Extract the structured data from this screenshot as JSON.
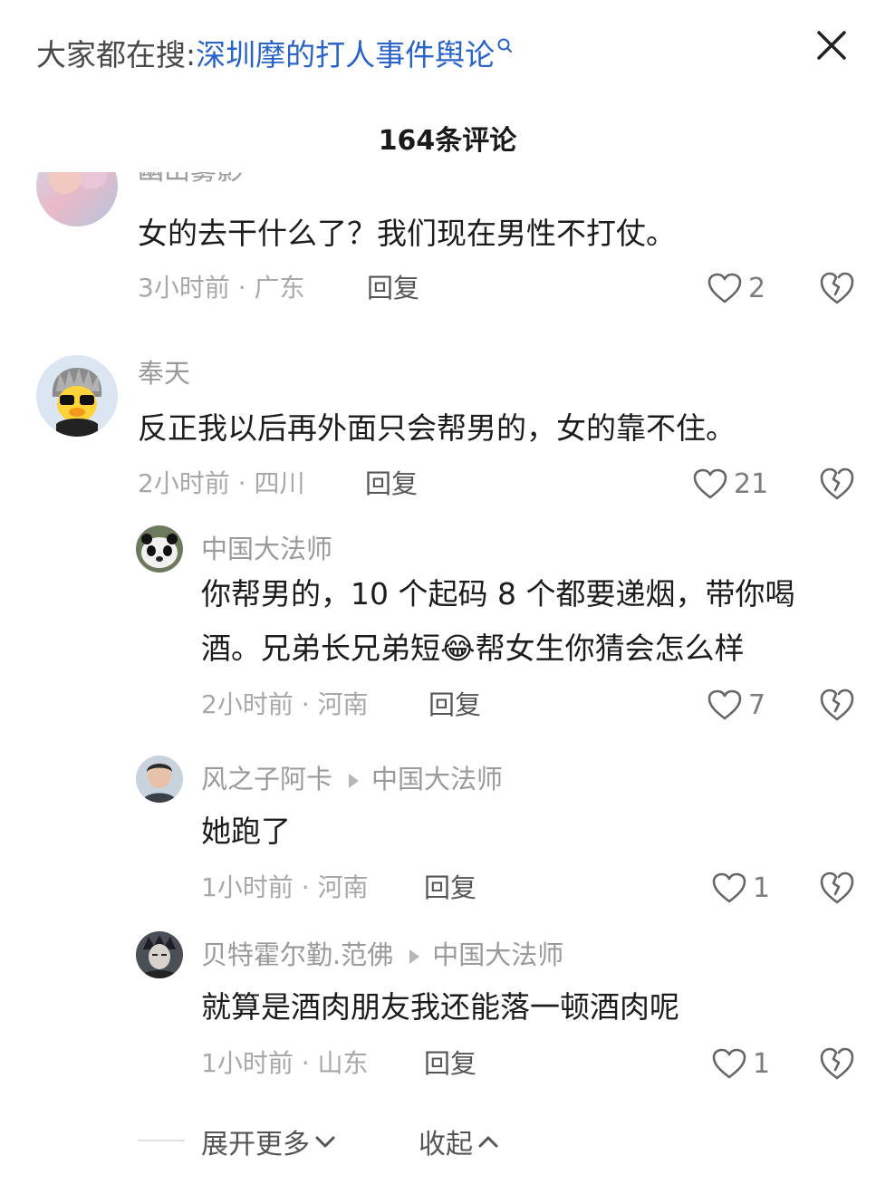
{
  "header": {
    "search_prefix": "大家都在搜:",
    "search_term": "深圳摩的打人事件舆论",
    "comment_count": "164条评论"
  },
  "comments": [
    {
      "username": "幽山雾影",
      "text": "女的去干什么了？我们现在男性不打仗。",
      "meta": "3小时前 · 广东",
      "reply_label": "回复",
      "likes": "2"
    },
    {
      "username": "奉天",
      "text": "反正我以后再外面只会帮男的，女的靠不住。",
      "meta": "2小时前 · 四川",
      "reply_label": "回复",
      "likes": "21"
    }
  ],
  "replies": [
    {
      "username": "中国大法师",
      "reply_to": "",
      "text_line1": "你帮男的，10 个起码 8 个都要递烟，带你喝",
      "text_line2a": "酒。兄弟长兄弟短",
      "emoji": "😂",
      "text_line2b": "帮女生你猜会怎么样",
      "meta": "2小时前 · 河南",
      "reply_label": "回复",
      "likes": "7"
    },
    {
      "username": "风之子阿卡",
      "reply_to": "中国大法师",
      "text": "她跑了",
      "meta": "1小时前 · 河南",
      "reply_label": "回复",
      "likes": "1"
    },
    {
      "username": "贝特霍尔勤.范佛",
      "reply_to": "中国大法师",
      "text": "就算是酒肉朋友我还能落一顿酒肉呢",
      "meta": "1小时前 · 山东",
      "reply_label": "回复",
      "likes": "1"
    }
  ],
  "footer": {
    "expand_label": "展开更多",
    "collapse_label": "收起"
  },
  "colors": {
    "link_blue": "#2a64c9",
    "muted": "#9a9a9a"
  },
  "icons": [
    "search-icon",
    "close-icon",
    "heart-icon",
    "broken-heart-icon",
    "chevron-down-icon",
    "chevron-up-icon"
  ]
}
